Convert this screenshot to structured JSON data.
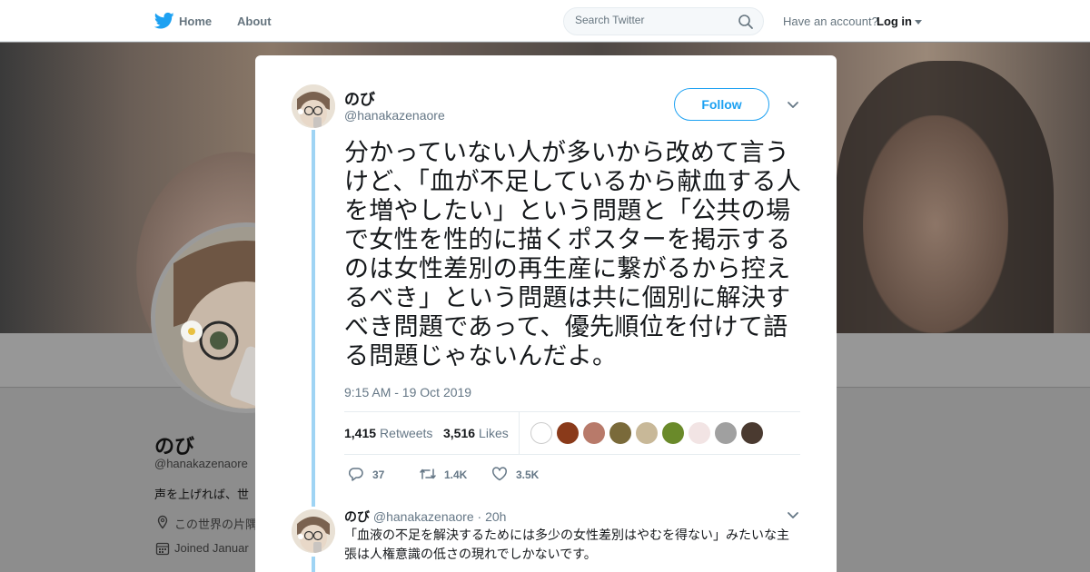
{
  "topbar": {
    "home_label": "Home",
    "about_label": "About",
    "search_placeholder": "Search Twitter",
    "account_prompt": "Have an account?",
    "login_label": "Log in",
    "brand_color": "#1da1f2"
  },
  "background_profile": {
    "name": "のび",
    "handle": "@hanakazenaore",
    "bio": "声を上げれば、世",
    "location": "この世界の片隅",
    "joined": "Joined Januar"
  },
  "tweet": {
    "name": "のび",
    "handle": "@hanakazenaore",
    "follow_label": "Follow",
    "text": "分かっていない人が多いから改めて言うけど、「血が不足しているから献血する人を増やしたい」という問題と「公共の場で女性を性的に描くポスターを掲示するのは女性差別の再生産に繋がるから控えるべき」という問題は共に個別に解決すべき問題であって、優先順位を付けて語る問題じゃないんだよ。",
    "timestamp": "9:15 AM - 19 Oct 2019",
    "retweets_count": "1,415",
    "retweets_label": "Retweets",
    "likes_count": "3,516",
    "likes_label": "Likes",
    "liker_colors": [
      "#ffffff",
      "#8a3a1a",
      "#b87a6a",
      "#7a6a3a",
      "#c8b898",
      "#6a8a2a",
      "#f2e4e4",
      "#a0a0a0",
      "#4a3a30"
    ],
    "reply_count": "37",
    "retweet_action_count": "1.4K",
    "like_action_count": "3.5K"
  },
  "reply": {
    "name": "のび",
    "handle": "@hanakazenaore",
    "separator": "·",
    "time": "20h",
    "text": "「血液の不足を解決するためには多少の女性差別はやむを得ない」みたいな主張は人権意識の低さの現れでしかないです。"
  }
}
